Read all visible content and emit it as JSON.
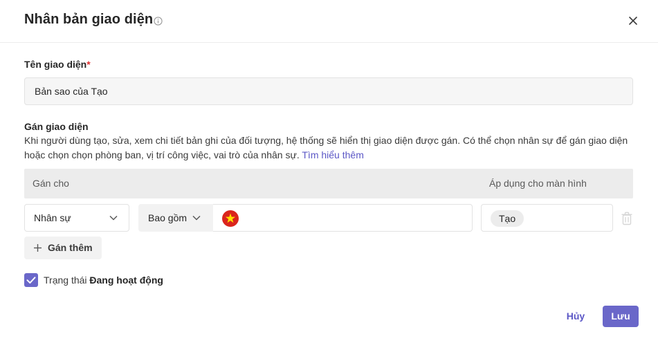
{
  "dialog": {
    "title": "Nhân bản giao diện"
  },
  "name_field": {
    "label": "Tên giao diện",
    "required_mark": "*",
    "value": "Bản sao của Tạo"
  },
  "assign": {
    "label": "Gán giao diện",
    "description": "Khi người dùng tạo, sửa, xem chi tiết bản ghi của đối tượng, hệ thống sẽ hiển thị giao diện được gán. Có thể chọn nhân sự để gán giao diện hoặc chọn chọn phòng ban, vị trí công việc, vai trò của nhân sự.",
    "learn_more": "Tìm hiểu thêm",
    "columns": {
      "assign_to": "Gán cho",
      "apply_screen": "Áp dụng cho màn hình"
    },
    "row": {
      "target_type": "Nhân sự",
      "condition": "Bao gồm",
      "screen_tag": "Tạo"
    },
    "add_more": "Gán thêm"
  },
  "status": {
    "prefix": "Trạng thái",
    "value": "Đang hoạt động",
    "checked": true
  },
  "footer": {
    "cancel": "Hủy",
    "save": "Lưu"
  },
  "colors": {
    "accent": "#6a67c9",
    "link": "#5b57c6",
    "flag_red": "#da251d",
    "flag_star": "#ffde00"
  }
}
